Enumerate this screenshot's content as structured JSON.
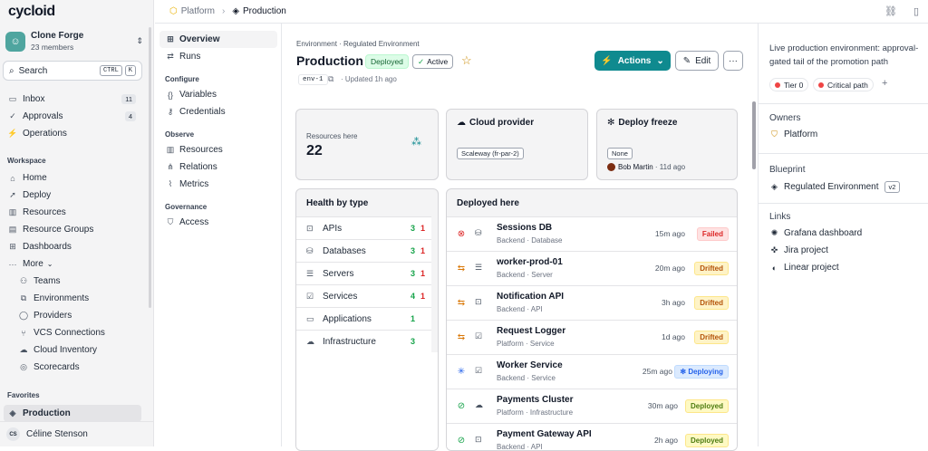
{
  "app": {
    "logo": "cycloid"
  },
  "org": {
    "name": "Clone Forge",
    "members": "23 members"
  },
  "search": {
    "label": "Search",
    "kbd1": "CTRL",
    "kbd2": "K"
  },
  "sidebar": {
    "top": [
      {
        "label": "Inbox",
        "badge": "11",
        "icon": "inbox-icon"
      },
      {
        "label": "Approvals",
        "badge": "4",
        "icon": "check-icon"
      },
      {
        "label": "Operations",
        "icon": "operations-icon"
      }
    ],
    "workspace_title": "Workspace",
    "workspace": [
      {
        "label": "Home",
        "icon": "home-icon"
      },
      {
        "label": "Deploy",
        "icon": "rocket-icon"
      },
      {
        "label": "Resources",
        "icon": "resources-icon"
      },
      {
        "label": "Resource Groups",
        "icon": "folder-icon"
      },
      {
        "label": "Dashboards",
        "icon": "dashboard-icon"
      },
      {
        "label": "More",
        "icon": "more-icon"
      },
      {
        "label": "Teams",
        "icon": "teams-icon"
      },
      {
        "label": "Environments",
        "icon": "environments-icon"
      },
      {
        "label": "Providers",
        "icon": "providers-icon"
      },
      {
        "label": "VCS Connections",
        "icon": "vcs-icon"
      },
      {
        "label": "Cloud Inventory",
        "icon": "cloud-icon"
      },
      {
        "label": "Scorecards",
        "icon": "scorecard-icon"
      }
    ],
    "favorites_title": "Favorites",
    "favorites": [
      {
        "label": "Production",
        "icon": "layers-icon"
      }
    ],
    "user": {
      "initials": "CS",
      "name": "Céline Stenson"
    }
  },
  "breadcrumb": {
    "parent": "Platform",
    "current": "Production"
  },
  "subnav": {
    "items": [
      {
        "label": "Overview"
      },
      {
        "label": "Runs"
      }
    ],
    "configure_title": "Configure",
    "configure": [
      {
        "label": "Variables"
      },
      {
        "label": "Credentials"
      }
    ],
    "observe_title": "Observe",
    "observe": [
      {
        "label": "Resources"
      },
      {
        "label": "Relations"
      },
      {
        "label": "Metrics"
      }
    ],
    "governance_title": "Governance",
    "governance": [
      {
        "label": "Access"
      }
    ]
  },
  "env": {
    "subtitle": "Environment · Regulated Environment",
    "title": "Production",
    "deployed_badge": "Deployed",
    "active_badge": "Active",
    "id": "env-1",
    "updated": "Updated 1h ago",
    "actions_label": "Actions",
    "edit_label": "Edit"
  },
  "cards": {
    "resources": {
      "label": "Resources here",
      "value": "22"
    },
    "cloud": {
      "title": "Cloud provider",
      "tag": "Scaleway (fr-par-2)"
    },
    "freeze": {
      "title": "Deploy freeze",
      "tag": "None",
      "user": "Bob Martin",
      "time": "11d ago"
    }
  },
  "health": {
    "title": "Health by type",
    "rows": [
      {
        "label": "APIs",
        "ok": "3",
        "bad": "1"
      },
      {
        "label": "Databases",
        "ok": "3",
        "bad": "1"
      },
      {
        "label": "Servers",
        "ok": "3",
        "bad": "1"
      },
      {
        "label": "Services",
        "ok": "4",
        "bad": "1"
      },
      {
        "label": "Applications",
        "ok": "1",
        "bad": ""
      },
      {
        "label": "Infrastructure",
        "ok": "3",
        "bad": ""
      }
    ]
  },
  "deployed": {
    "title": "Deployed here",
    "rows": [
      {
        "name": "Sessions DB",
        "sub": "Backend · Database",
        "time": "15m ago",
        "status": "Failed"
      },
      {
        "name": "worker-prod-01",
        "sub": "Backend · Server",
        "time": "20m ago",
        "status": "Drifted"
      },
      {
        "name": "Notification API",
        "sub": "Backend · API",
        "time": "3h ago",
        "status": "Drifted"
      },
      {
        "name": "Request Logger",
        "sub": "Platform · Service",
        "time": "1d ago",
        "status": "Drifted"
      },
      {
        "name": "Worker Service",
        "sub": "Backend · Service",
        "time": "25m ago",
        "status": "Deploying"
      },
      {
        "name": "Payments Cluster",
        "sub": "Platform · Infrastructure",
        "time": "30m ago",
        "status": "Deployed"
      },
      {
        "name": "Payment Gateway API",
        "sub": "Backend · API",
        "time": "2h ago",
        "status": "Deployed"
      }
    ]
  },
  "right": {
    "description": "Live production environment: approval-gated tail of the promotion path",
    "tags": [
      {
        "label": "Tier 0"
      },
      {
        "label": "Critical path"
      }
    ],
    "owners_title": "Owners",
    "owner": "Platform",
    "blueprint_title": "Blueprint",
    "blueprint": "Regulated Environment",
    "blueprint_version": "v2",
    "links_title": "Links",
    "links": [
      {
        "label": "Grafana dashboard"
      },
      {
        "label": "Jira project"
      },
      {
        "label": "Linear project"
      }
    ]
  },
  "colors": {
    "accent": "#0f8a8f",
    "deployed_badge": "#dcfce7",
    "active": "#16a34a"
  }
}
